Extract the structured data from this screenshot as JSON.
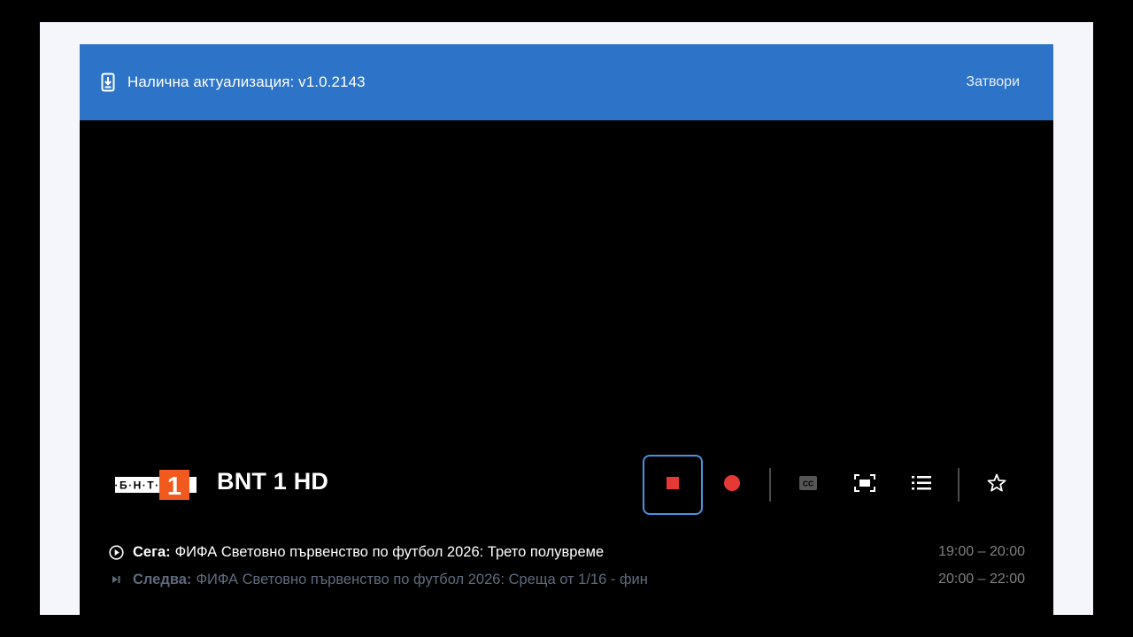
{
  "update_banner": {
    "message": "Налична актуализация: v1.0.2143",
    "close_label": "Затвори"
  },
  "channel": {
    "logo_text": "БНТ",
    "logo_number": "1",
    "name": "BNT 1 HD"
  },
  "controls": [
    {
      "name": "stop",
      "icon": "stop-icon",
      "focused": true
    },
    {
      "name": "record",
      "icon": "record-icon"
    },
    {
      "name": "subtitles",
      "icon": "cc-icon"
    },
    {
      "name": "aspect",
      "icon": "fit-screen-icon"
    },
    {
      "name": "channel-list",
      "icon": "list-icon"
    },
    {
      "name": "favorite",
      "icon": "star-outline-icon"
    }
  ],
  "epg": {
    "now": {
      "label": "Сега:",
      "title": "ФИФА Световно първенство по футбол 2026: Трето полувреме",
      "time": "19:00 – 20:00"
    },
    "next": {
      "label": "Следва:",
      "title": "ФИФА Световно първенство по футбол 2026: Среща от 1/16 - фин",
      "time": "20:00 – 22:00"
    }
  },
  "colors": {
    "banner": "#2d74c8",
    "focus_ring": "#4a92e2",
    "record_red": "#e53935",
    "logo_orange": "#f05a1e"
  }
}
